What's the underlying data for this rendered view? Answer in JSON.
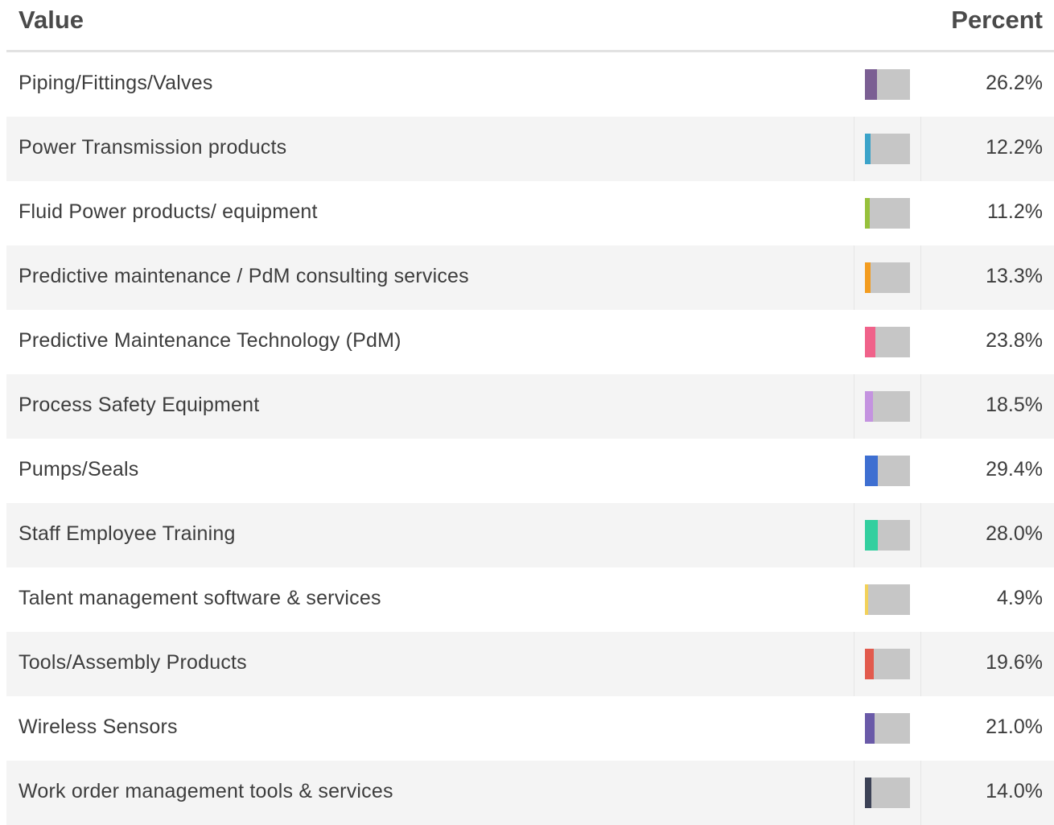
{
  "header": {
    "value_label": "Value",
    "percent_label": "Percent"
  },
  "chart_data": {
    "type": "table",
    "columns": [
      "Value",
      "Percent"
    ],
    "rows": [
      {
        "label": "Piping/Fittings/Valves",
        "percent": 26.2,
        "percent_text": "26.2%",
        "color": "#7b5f93"
      },
      {
        "label": "Power Transmission products",
        "percent": 12.2,
        "percent_text": "12.2%",
        "color": "#3ba3c9"
      },
      {
        "label": "Fluid Power products/ equipment",
        "percent": 11.2,
        "percent_text": "11.2%",
        "color": "#97c13c"
      },
      {
        "label": "Predictive maintenance / PdM consulting services",
        "percent": 13.3,
        "percent_text": "13.3%",
        "color": "#f39c1f"
      },
      {
        "label": "Predictive Maintenance Technology (PdM)",
        "percent": 23.8,
        "percent_text": "23.8%",
        "color": "#f0628a"
      },
      {
        "label": "Process Safety Equipment",
        "percent": 18.5,
        "percent_text": "18.5%",
        "color": "#c493e0"
      },
      {
        "label": "Pumps/Seals",
        "percent": 29.4,
        "percent_text": "29.4%",
        "color": "#3e6fd1"
      },
      {
        "label": "Staff Employee Training",
        "percent": 28.0,
        "percent_text": "28.0%",
        "color": "#33cf9f"
      },
      {
        "label": "Talent management software & services",
        "percent": 4.9,
        "percent_text": "4.9%",
        "color": "#f2d15a"
      },
      {
        "label": "Tools/Assembly Products",
        "percent": 19.6,
        "percent_text": "19.6%",
        "color": "#e25a4d"
      },
      {
        "label": "Wireless Sensors",
        "percent": 21.0,
        "percent_text": "21.0%",
        "color": "#6a5aa8"
      },
      {
        "label": "Work order management tools & services",
        "percent": 14.0,
        "percent_text": "14.0%",
        "color": "#3c4256"
      }
    ]
  }
}
